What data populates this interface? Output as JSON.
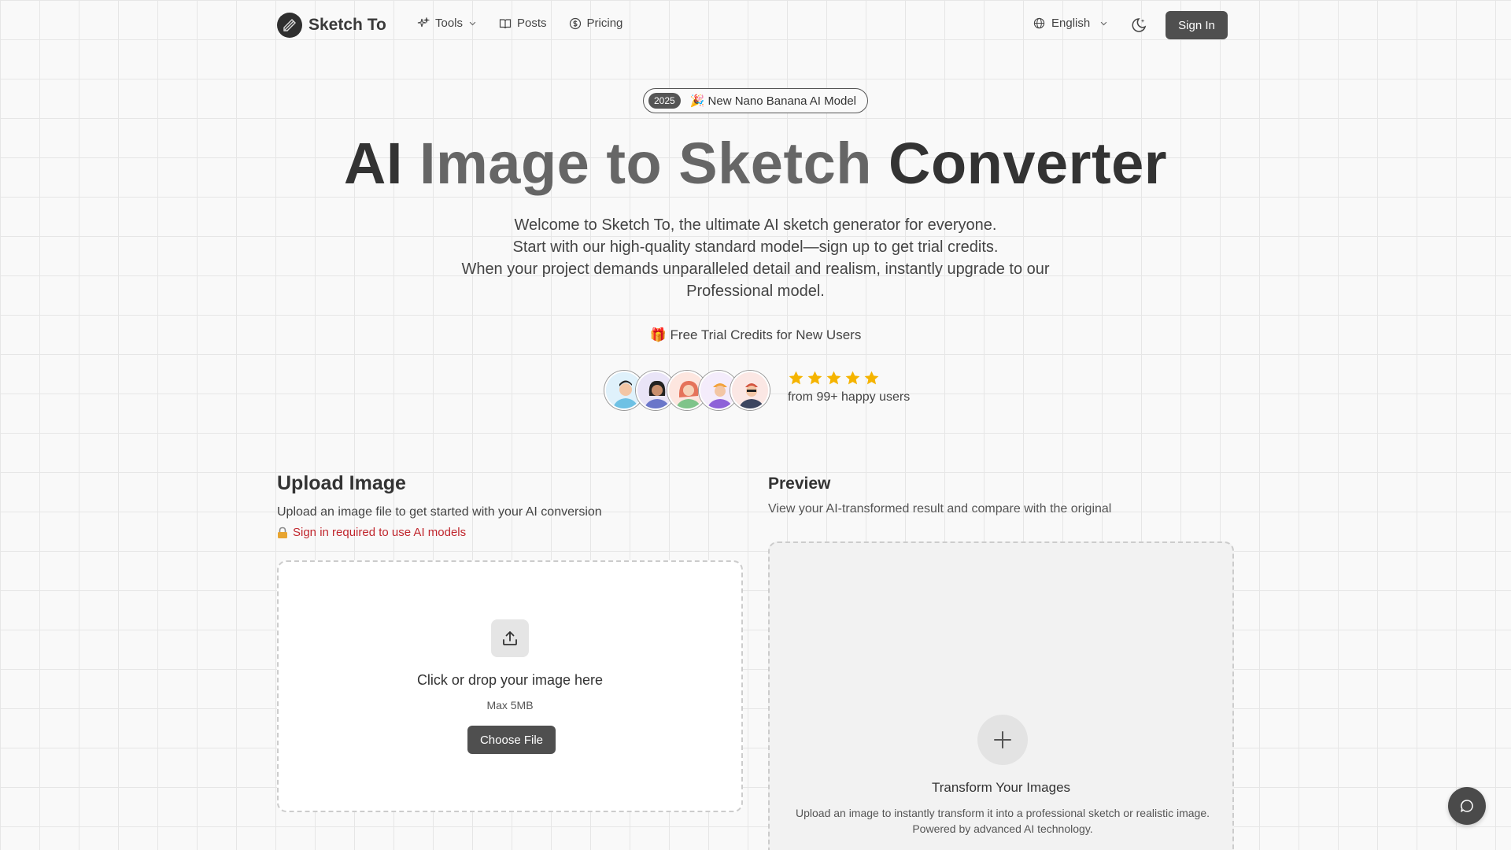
{
  "header": {
    "brand": "Sketch To",
    "nav": [
      {
        "label": "Tools",
        "icon": "sparkles-icon"
      },
      {
        "label": "Posts",
        "icon": "book-icon"
      },
      {
        "label": "Pricing",
        "icon": "dollar-circle-icon"
      }
    ],
    "language": "English",
    "sign_in": "Sign In"
  },
  "hero": {
    "badge_year": "2025",
    "badge_text": "🎉 New Nano Banana AI Model",
    "title_part1": "AI",
    "title_part2": "Image to Sketch",
    "title_part3": "Converter",
    "desc_line1": "Welcome to Sketch To, the ultimate AI sketch generator for everyone.",
    "desc_line2": "Start with our high-quality standard model—sign up to get trial credits.",
    "desc_line3": "When your project demands unparalleled detail and realism, instantly upgrade to our Professional model.",
    "trial": "🎁 Free Trial Credits for New Users",
    "rating_stars": 5,
    "rating_text": "from 99+ happy users"
  },
  "upload": {
    "title": "Upload Image",
    "description": "Upload an image file to get started with your AI conversion",
    "warning": "Sign in required to use AI models",
    "drop_title": "Click or drop your image here",
    "drop_max": "Max 5MB",
    "choose_file": "Choose File"
  },
  "preview": {
    "title": "Preview",
    "description": "View your AI-transformed result and compare with the original",
    "empty_title": "Transform Your Images",
    "empty_desc": "Upload an image to instantly transform it into a professional sketch or realistic image. Powered by advanced AI technology."
  },
  "colors": {
    "accent_button": "#4f4f4f",
    "warning_red": "#c0262d",
    "star_gold": "#f5b400"
  }
}
